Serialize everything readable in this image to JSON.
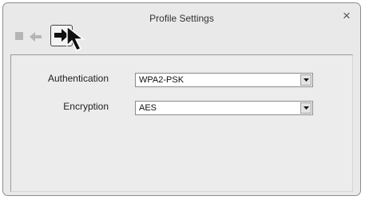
{
  "window": {
    "title": "Profile Settings",
    "close_glyph": "×"
  },
  "toolbar": {
    "buttons": [
      {
        "name": "stop",
        "icon": "square-stop-icon",
        "enabled": false
      },
      {
        "name": "back",
        "icon": "arrow-left-icon",
        "enabled": false
      },
      {
        "name": "forward",
        "icon": "arrow-right-icon",
        "enabled": true,
        "highlighted": true
      }
    ]
  },
  "form": {
    "authentication": {
      "label": "Authentication",
      "value": "WPA2-PSK"
    },
    "encryption": {
      "label": "Encryption",
      "value": "AES"
    }
  },
  "colors": {
    "window_bg": "#e9e9e9",
    "panel_bg": "#ececec",
    "disabled_icon": "#b5b5b5",
    "active_icon": "#111111"
  }
}
